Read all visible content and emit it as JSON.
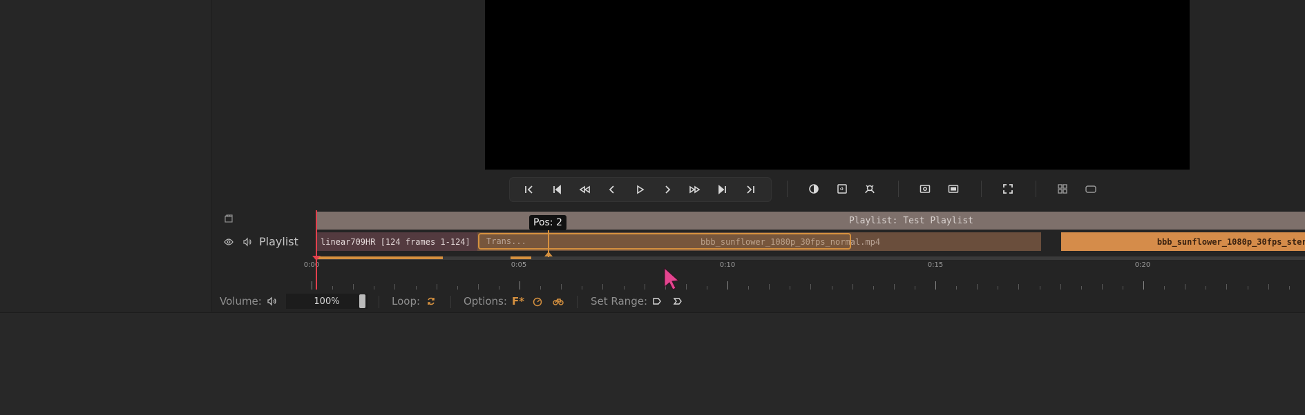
{
  "toolbar": {
    "transport": [
      {
        "name": "go-to-start-icon"
      },
      {
        "name": "previous-clip-icon"
      },
      {
        "name": "rewind-icon"
      },
      {
        "name": "step-back-icon"
      },
      {
        "name": "play-icon"
      },
      {
        "name": "step-forward-icon"
      },
      {
        "name": "fast-forward-icon"
      },
      {
        "name": "next-clip-icon"
      },
      {
        "name": "go-to-end-icon"
      }
    ],
    "view": [
      {
        "name": "contrast-icon"
      },
      {
        "name": "mask-icon"
      },
      {
        "name": "color-picker-icon"
      },
      {
        "name": "snapshot-icon"
      },
      {
        "name": "letterbox-icon"
      },
      {
        "name": "fullscreen-icon"
      },
      {
        "name": "grid-layout-icon"
      },
      {
        "name": "single-layout-icon"
      }
    ]
  },
  "timeline": {
    "playlist_header": "Playlist: Test Playlist",
    "track_label": "Playlist",
    "clips": [
      {
        "label": "linear709HR [124 frames 1-124]"
      },
      {
        "label": "bbb_sunflower_1080p_30fps_normal.mp4"
      },
      {
        "label": "bbb_sunflower_1080p_30fps_stereo"
      }
    ],
    "transition_label": "Trans...",
    "hover_tooltip": "Pos: 2",
    "ticks": [
      "0:00",
      "0:05",
      "0:10",
      "0:15",
      "0:20"
    ]
  },
  "status_bar": {
    "volume_label": "Volume:",
    "volume_value": "100%",
    "loop_label": "Loop:",
    "options_label": "Options:",
    "options_f": "F*",
    "set_range_label": "Set Range:"
  },
  "colors": {
    "accent": "#d6913f",
    "playhead": "#e2404d"
  }
}
